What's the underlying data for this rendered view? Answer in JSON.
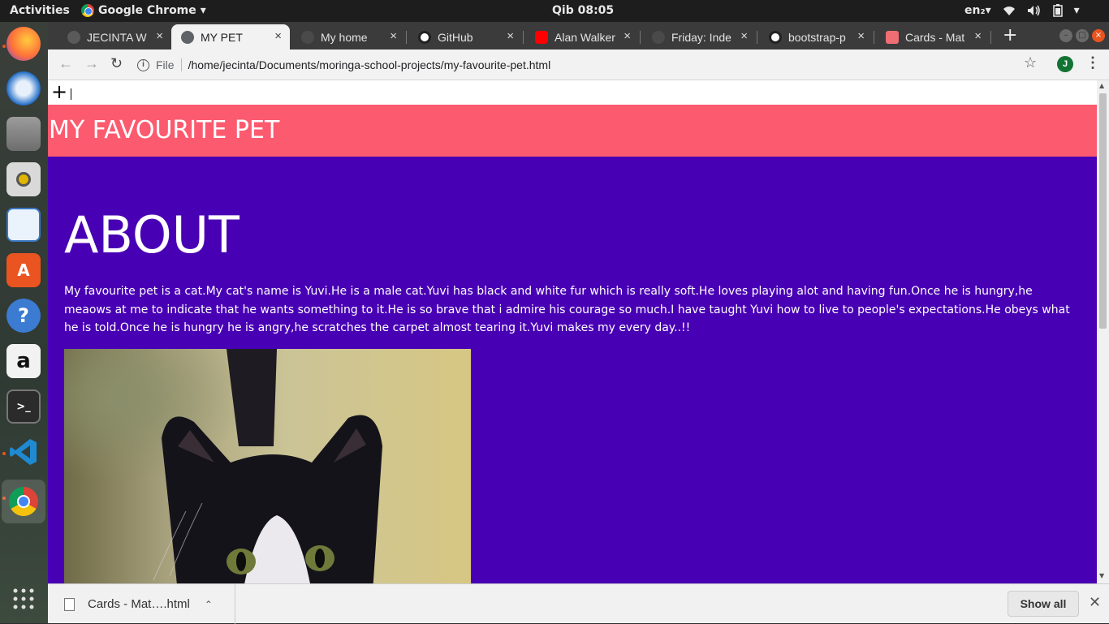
{
  "system_bar": {
    "activities": "Activities",
    "app_name": "Google Chrome",
    "app_menu_caret": "▾",
    "clock": "Qib 08:05",
    "language": "en₂",
    "language_caret": "▾"
  },
  "dock": {
    "items": [
      "firefox-icon",
      "thunderbird-icon",
      "files-icon",
      "rhythmbox-icon",
      "libreoffice-writer-icon",
      "software-center-icon",
      "help-icon",
      "amazon-icon",
      "terminal-icon",
      "vscode-icon",
      "chrome-icon",
      "app-grid-icon"
    ]
  },
  "tabs": [
    {
      "title": "JECINTA W",
      "active": false,
      "favicon_color": "#5a5a5a"
    },
    {
      "title": "MY PET",
      "active": true,
      "favicon_color": "#5f6368"
    },
    {
      "title": "My home",
      "active": false,
      "favicon_color": "#4a4a4a"
    },
    {
      "title": "GitHub",
      "active": false,
      "favicon_color": "#ffffff"
    },
    {
      "title": "Alan Walker",
      "active": false,
      "favicon_color": "#ff0000"
    },
    {
      "title": "Friday: Inde",
      "active": false,
      "favicon_color": "#4a4a4a"
    },
    {
      "title": "bootstrap-p",
      "active": false,
      "favicon_color": "#ffffff"
    },
    {
      "title": "Cards - Mat",
      "active": false,
      "favicon_color": "#ee6e73"
    }
  ],
  "tab_close_glyph": "×",
  "new_tab_glyph": "+",
  "toolbar": {
    "back": "←",
    "forward": "→",
    "reload": "↻",
    "info": "i",
    "file_label": "File",
    "url": "/home/jecinta/Documents/moringa-school-projects/my-favourite-pet.html",
    "star": "☆",
    "avatar_letter": "J",
    "menu": "⋮"
  },
  "page": {
    "plus": "+",
    "header_title": "MY FAVOURITE PET",
    "header_color": "#fc5a6f",
    "main_color": "#4800b4",
    "about_title": "ABOUT",
    "about_text": "My favourite pet is a cat.My cat's name is Yuvi.He is a male cat.Yuvi has black and white fur which is really soft.He loves playing alot and having fun.Once he is hungry,he meaows at me to indicate that he wants something to it.He is so brave that i admire his courage so much.I have taught Yuvi how to live to people's expectations.He obeys what he is told.Once he is hungry he is angry,he scratches the carpet almost tearing it.Yuvi makes my every day..!!"
  },
  "download_shelf": {
    "filename": "Cards - Mat….html",
    "caret": "⌃",
    "show_all": "Show all",
    "close": "✕"
  }
}
